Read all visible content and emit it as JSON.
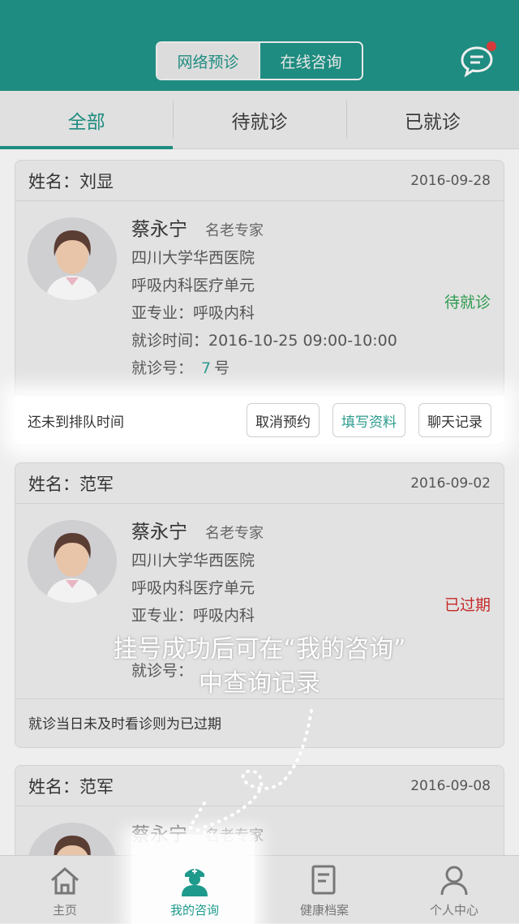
{
  "header": {
    "segments": [
      "网络预诊",
      "在线咨询"
    ],
    "active_segment": 0,
    "chat_icon": "chat-bubble-icon",
    "badge_color": "#d63a3a"
  },
  "tabs": [
    "全部",
    "待就诊",
    "已就诊"
  ],
  "active_tab": 0,
  "cards": [
    {
      "patient": "姓名：刘显",
      "date": "2016-09-28",
      "doctor": "蔡永宁",
      "title": "名老专家",
      "hospital": "四川大学华西医院",
      "unit": "呼吸内科医疗单元",
      "specialty": "亚专业：呼吸内科",
      "time": "就诊时间：2016-10-25  09:00-10:00",
      "queue_label": "就诊号：",
      "queue_no": "7",
      "queue_unit": "号",
      "status": "待就诊",
      "footer_note": "还未到排队时间",
      "actions": [
        "取消预约",
        "填写资料",
        "聊天记录"
      ]
    },
    {
      "patient": "姓名：范军",
      "date": "2016-09-02",
      "doctor": "蔡永宁",
      "title": "名老专家",
      "hospital": "四川大学华西医院",
      "unit": "呼吸内科医疗单元",
      "specialty": "亚专业：呼吸内科",
      "queue_label": "就诊号：",
      "status": "已过期",
      "footer_note": "就诊当日未及时看诊则为已过期"
    },
    {
      "patient": "姓名：范军",
      "date": "2016-09-08",
      "doctor": "蔡永宁",
      "title": "名老专家"
    }
  ],
  "overlay": {
    "line1": "挂号成功后可在“我的咨询”",
    "line2": "中查询记录"
  },
  "tabbar": [
    {
      "label": "主页",
      "icon": "home-icon"
    },
    {
      "label": "我的咨询",
      "icon": "doctor-icon"
    },
    {
      "label": "健康档案",
      "icon": "document-icon"
    },
    {
      "label": "个人中心",
      "icon": "person-icon"
    }
  ],
  "active_tabbar": 1,
  "colors": {
    "brand": "#1e8c80",
    "waiting": "#2c9a4e",
    "expired": "#c62828"
  }
}
